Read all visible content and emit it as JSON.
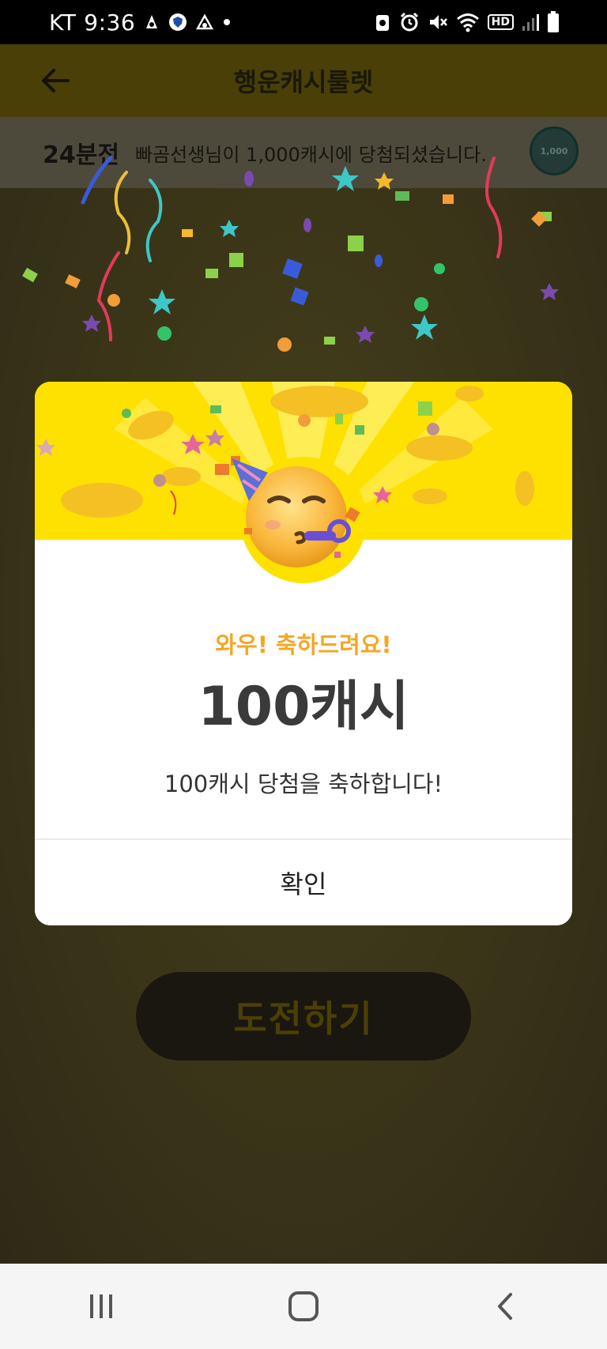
{
  "status_bar": {
    "carrier": "KT",
    "time": "9:36",
    "icons_left": [
      "app-notification-icon",
      "shield-icon",
      "app-notification-icon",
      "dot-icon"
    ],
    "icons_right": [
      "recycle-icon",
      "alarm-icon",
      "mute-icon",
      "wifi-icon",
      "hd-icon",
      "signal-icon",
      "battery-icon"
    ],
    "hd_label": "HD"
  },
  "app_bar": {
    "title": "행운캐시룰렛",
    "back_icon": "arrow-left-icon"
  },
  "ticker": {
    "time_ago": "24분전",
    "message": "빠곰선생님이 1,000캐시에 당첨되셨습니다.",
    "coin_label": "1,000"
  },
  "main": {
    "challenge_button": "도전하기"
  },
  "modal": {
    "congrats": "와우! 축하드려요!",
    "amount": "100캐시",
    "description": "100캐시 당첨을 축하합니다!",
    "confirm_button": "확인",
    "emoji": "partying-face-icon"
  },
  "nav_bar": {
    "recent_icon": "recent-apps-icon",
    "home_icon": "home-icon",
    "back_icon": "back-icon"
  },
  "colors": {
    "accent_yellow": "#ffe100",
    "congrats_orange": "#f5a623",
    "amount_text": "#3a3a3a"
  }
}
